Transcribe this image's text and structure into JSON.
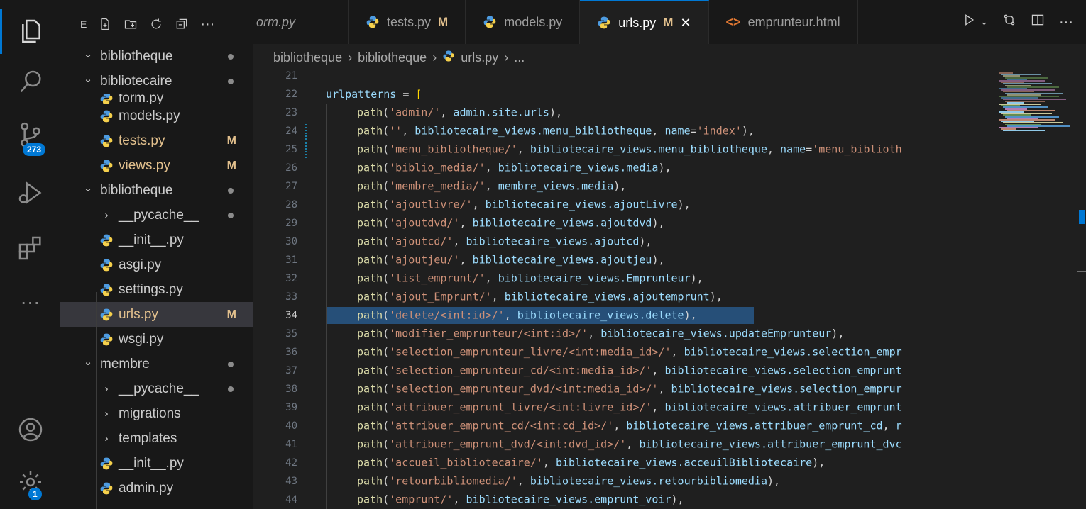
{
  "activity_bar": {
    "source_control_badge": "273",
    "settings_badge": "1"
  },
  "sidebar": {
    "toolbar_prefix": "E",
    "tree": [
      {
        "label": "bibliotheque",
        "type": "folder",
        "open": true,
        "depth": 0,
        "status": "dot"
      },
      {
        "label": "bibliotecaire",
        "type": "folder",
        "open": true,
        "depth": 0,
        "status": "dot"
      },
      {
        "label": "form.py",
        "type": "py",
        "depth": 1,
        "status": "",
        "cut": true
      },
      {
        "label": "models.py",
        "type": "py",
        "depth": 1,
        "status": ""
      },
      {
        "label": "tests.py",
        "type": "py",
        "depth": 1,
        "status": "M"
      },
      {
        "label": "views.py",
        "type": "py",
        "depth": 1,
        "status": "M"
      },
      {
        "label": "bibliotheque",
        "type": "folder",
        "open": true,
        "depth": 0,
        "status": "dot"
      },
      {
        "label": "__pycache__",
        "type": "folder",
        "open": false,
        "depth": 1,
        "status": "dot"
      },
      {
        "label": "__init__.py",
        "type": "py",
        "depth": 1,
        "status": ""
      },
      {
        "label": "asgi.py",
        "type": "py",
        "depth": 1,
        "status": ""
      },
      {
        "label": "settings.py",
        "type": "py",
        "depth": 1,
        "status": ""
      },
      {
        "label": "urls.py",
        "type": "py",
        "depth": 1,
        "status": "M",
        "selected": true
      },
      {
        "label": "wsgi.py",
        "type": "py",
        "depth": 1,
        "status": ""
      },
      {
        "label": "membre",
        "type": "folder",
        "open": true,
        "depth": 0,
        "status": "dot"
      },
      {
        "label": "__pycache__",
        "type": "folder",
        "open": false,
        "depth": 1,
        "status": "dot"
      },
      {
        "label": "migrations",
        "type": "folder",
        "open": false,
        "depth": 1,
        "status": ""
      },
      {
        "label": "templates",
        "type": "folder",
        "open": false,
        "depth": 1,
        "status": ""
      },
      {
        "label": "__init__.py",
        "type": "py",
        "depth": 1,
        "status": ""
      },
      {
        "label": "admin.py",
        "type": "py",
        "depth": 1,
        "status": ""
      }
    ]
  },
  "tabs": [
    {
      "label": "orm.py",
      "icon": "",
      "flag": "",
      "active": false,
      "italic": true
    },
    {
      "label": "tests.py",
      "icon": "python-icon",
      "flag": "M",
      "active": false
    },
    {
      "label": "models.py",
      "icon": "python-icon",
      "flag": "",
      "active": false
    },
    {
      "label": "urls.py",
      "icon": "python-icon",
      "flag": "M",
      "active": true
    },
    {
      "label": "emprunteur.html",
      "icon": "html-icon",
      "flag": "",
      "active": false
    }
  ],
  "breadcrumb": [
    "bibliotheque",
    "bibliotheque",
    "urls.py",
    "..."
  ],
  "editor": {
    "current_line": 34,
    "lines": [
      {
        "n": "21",
        "tokens": []
      },
      {
        "n": "22",
        "tokens": [
          [
            "id",
            "urlpatterns"
          ],
          [
            "op",
            " = "
          ],
          [
            "br",
            "["
          ]
        ],
        "indent": 0
      },
      {
        "n": "23",
        "tokens": [
          [
            "fn",
            "path"
          ],
          [
            "pun",
            "("
          ],
          [
            "str",
            "'admin/'"
          ],
          [
            "pun",
            ", "
          ],
          [
            "id",
            "admin.site.urls"
          ],
          [
            "pun",
            "),"
          ]
        ],
        "indent": 1
      },
      {
        "n": "24",
        "tokens": [
          [
            "fn",
            "path"
          ],
          [
            "pun",
            "("
          ],
          [
            "str",
            "''"
          ],
          [
            "pun",
            ", "
          ],
          [
            "id",
            "bibliotecaire_views.menu_bibliotheque"
          ],
          [
            "pun",
            ", "
          ],
          [
            "id",
            "name"
          ],
          [
            "op",
            "="
          ],
          [
            "str",
            "'index'"
          ],
          [
            "pun",
            "),"
          ]
        ],
        "indent": 1,
        "mark": true
      },
      {
        "n": "25",
        "tokens": [
          [
            "fn",
            "path"
          ],
          [
            "pun",
            "("
          ],
          [
            "str",
            "'menu_bibliotheque/'"
          ],
          [
            "pun",
            ", "
          ],
          [
            "id",
            "bibliotecaire_views.menu_bibliotheque"
          ],
          [
            "pun",
            ", "
          ],
          [
            "id",
            "name"
          ],
          [
            "op",
            "="
          ],
          [
            "str",
            "'menu_biblioth"
          ]
        ],
        "indent": 1,
        "mark": true
      },
      {
        "n": "26",
        "tokens": [
          [
            "fn",
            "path"
          ],
          [
            "pun",
            "("
          ],
          [
            "str",
            "'biblio_media/'"
          ],
          [
            "pun",
            ", "
          ],
          [
            "id",
            "bibliotecaire_views.media"
          ],
          [
            "pun",
            "),"
          ]
        ],
        "indent": 1
      },
      {
        "n": "27",
        "tokens": [
          [
            "fn",
            "path"
          ],
          [
            "pun",
            "("
          ],
          [
            "str",
            "'membre_media/'"
          ],
          [
            "pun",
            ", "
          ],
          [
            "id",
            "membre_views.media"
          ],
          [
            "pun",
            "),"
          ]
        ],
        "indent": 1
      },
      {
        "n": "28",
        "tokens": [
          [
            "fn",
            "path"
          ],
          [
            "pun",
            "("
          ],
          [
            "str",
            "'ajoutlivre/'"
          ],
          [
            "pun",
            ", "
          ],
          [
            "id",
            "bibliotecaire_views.ajoutLivre"
          ],
          [
            "pun",
            "),"
          ]
        ],
        "indent": 1
      },
      {
        "n": "29",
        "tokens": [
          [
            "fn",
            "path"
          ],
          [
            "pun",
            "("
          ],
          [
            "str",
            "'ajoutdvd/'"
          ],
          [
            "pun",
            ", "
          ],
          [
            "id",
            "bibliotecaire_views.ajoutdvd"
          ],
          [
            "pun",
            "),"
          ]
        ],
        "indent": 1
      },
      {
        "n": "30",
        "tokens": [
          [
            "fn",
            "path"
          ],
          [
            "pun",
            "("
          ],
          [
            "str",
            "'ajoutcd/'"
          ],
          [
            "pun",
            ", "
          ],
          [
            "id",
            "bibliotecaire_views.ajoutcd"
          ],
          [
            "pun",
            "),"
          ]
        ],
        "indent": 1
      },
      {
        "n": "31",
        "tokens": [
          [
            "fn",
            "path"
          ],
          [
            "pun",
            "("
          ],
          [
            "str",
            "'ajoutjeu/'"
          ],
          [
            "pun",
            ", "
          ],
          [
            "id",
            "bibliotecaire_views.ajoutjeu"
          ],
          [
            "pun",
            "),"
          ]
        ],
        "indent": 1
      },
      {
        "n": "32",
        "tokens": [
          [
            "fn",
            "path"
          ],
          [
            "pun",
            "("
          ],
          [
            "str",
            "'list_emprunt/'"
          ],
          [
            "pun",
            ", "
          ],
          [
            "id",
            "bibliotecaire_views.Emprunteur"
          ],
          [
            "pun",
            "),"
          ]
        ],
        "indent": 1
      },
      {
        "n": "33",
        "tokens": [
          [
            "fn",
            "path"
          ],
          [
            "pun",
            "("
          ],
          [
            "str",
            "'ajout_Emprunt/'"
          ],
          [
            "pun",
            ", "
          ],
          [
            "id",
            "bibliotecaire_views.ajoutemprunt"
          ],
          [
            "pun",
            "),"
          ]
        ],
        "indent": 1
      },
      {
        "n": "34",
        "tokens": [
          [
            "fn",
            "path"
          ],
          [
            "pun",
            "("
          ],
          [
            "str",
            "'delete/<int:id>/'"
          ],
          [
            "pun",
            ", "
          ],
          [
            "id",
            "bibliotecaire_views.delete"
          ],
          [
            "pun",
            "),"
          ]
        ],
        "indent": 1,
        "selected": true
      },
      {
        "n": "35",
        "tokens": [
          [
            "fn",
            "path"
          ],
          [
            "pun",
            "("
          ],
          [
            "str",
            "'modifier_emprunteur/<int:id>/'"
          ],
          [
            "pun",
            ", "
          ],
          [
            "id",
            "bibliotecaire_views.updateEmprunteur"
          ],
          [
            "pun",
            "),"
          ]
        ],
        "indent": 1
      },
      {
        "n": "36",
        "tokens": [
          [
            "fn",
            "path"
          ],
          [
            "pun",
            "("
          ],
          [
            "str",
            "'selection_emprunteur_livre/<int:media_id>/'"
          ],
          [
            "pun",
            ", "
          ],
          [
            "id",
            "bibliotecaire_views.selection_empr"
          ]
        ],
        "indent": 1
      },
      {
        "n": "37",
        "tokens": [
          [
            "fn",
            "path"
          ],
          [
            "pun",
            "("
          ],
          [
            "str",
            "'selection_emprunteur_cd/<int:media_id>/'"
          ],
          [
            "pun",
            ", "
          ],
          [
            "id",
            "bibliotecaire_views.selection_emprunt"
          ]
        ],
        "indent": 1
      },
      {
        "n": "38",
        "tokens": [
          [
            "fn",
            "path"
          ],
          [
            "pun",
            "("
          ],
          [
            "str",
            "'selection_emprunteur_dvd/<int:media_id>/'"
          ],
          [
            "pun",
            ", "
          ],
          [
            "id",
            "bibliotecaire_views.selection_emprur"
          ]
        ],
        "indent": 1
      },
      {
        "n": "39",
        "tokens": [
          [
            "fn",
            "path"
          ],
          [
            "pun",
            "("
          ],
          [
            "str",
            "'attribuer_emprunt_livre/<int:livre_id>/'"
          ],
          [
            "pun",
            ", "
          ],
          [
            "id",
            "bibliotecaire_views.attribuer_emprunt"
          ]
        ],
        "indent": 1
      },
      {
        "n": "40",
        "tokens": [
          [
            "fn",
            "path"
          ],
          [
            "pun",
            "("
          ],
          [
            "str",
            "'attribuer_emprunt_cd/<int:cd_id>/'"
          ],
          [
            "pun",
            ", "
          ],
          [
            "id",
            "bibliotecaire_views.attribuer_emprunt_cd"
          ],
          [
            "pun",
            ", "
          ],
          [
            "id",
            "r"
          ]
        ],
        "indent": 1
      },
      {
        "n": "41",
        "tokens": [
          [
            "fn",
            "path"
          ],
          [
            "pun",
            "("
          ],
          [
            "str",
            "'attribuer_emprunt_dvd/<int:dvd_id>/'"
          ],
          [
            "pun",
            ", "
          ],
          [
            "id",
            "bibliotecaire_views.attribuer_emprunt_dvc"
          ]
        ],
        "indent": 1
      },
      {
        "n": "42",
        "tokens": [
          [
            "fn",
            "path"
          ],
          [
            "pun",
            "("
          ],
          [
            "str",
            "'accueil_bibliotecaire/'"
          ],
          [
            "pun",
            ", "
          ],
          [
            "id",
            "bibliotecaire_views.acceuilBibliotecaire"
          ],
          [
            "pun",
            "),"
          ]
        ],
        "indent": 1
      },
      {
        "n": "43",
        "tokens": [
          [
            "fn",
            "path"
          ],
          [
            "pun",
            "("
          ],
          [
            "str",
            "'retourbibliomedia/'"
          ],
          [
            "pun",
            ", "
          ],
          [
            "id",
            "bibliotecaire_views.retourbibliomedia"
          ],
          [
            "pun",
            "),"
          ]
        ],
        "indent": 1
      },
      {
        "n": "44",
        "tokens": [
          [
            "fn",
            "path"
          ],
          [
            "pun",
            "("
          ],
          [
            "str",
            "'emprunt/'"
          ],
          [
            "pun",
            ", "
          ],
          [
            "id",
            "bibliotecaire_views.emprunt_voir"
          ],
          [
            "pun",
            "),"
          ]
        ],
        "indent": 1
      }
    ]
  },
  "colors": {
    "accent": "#0078d4",
    "modified": "#e2c08d",
    "selection": "#264f78",
    "python_icon": "#4d9be0"
  }
}
